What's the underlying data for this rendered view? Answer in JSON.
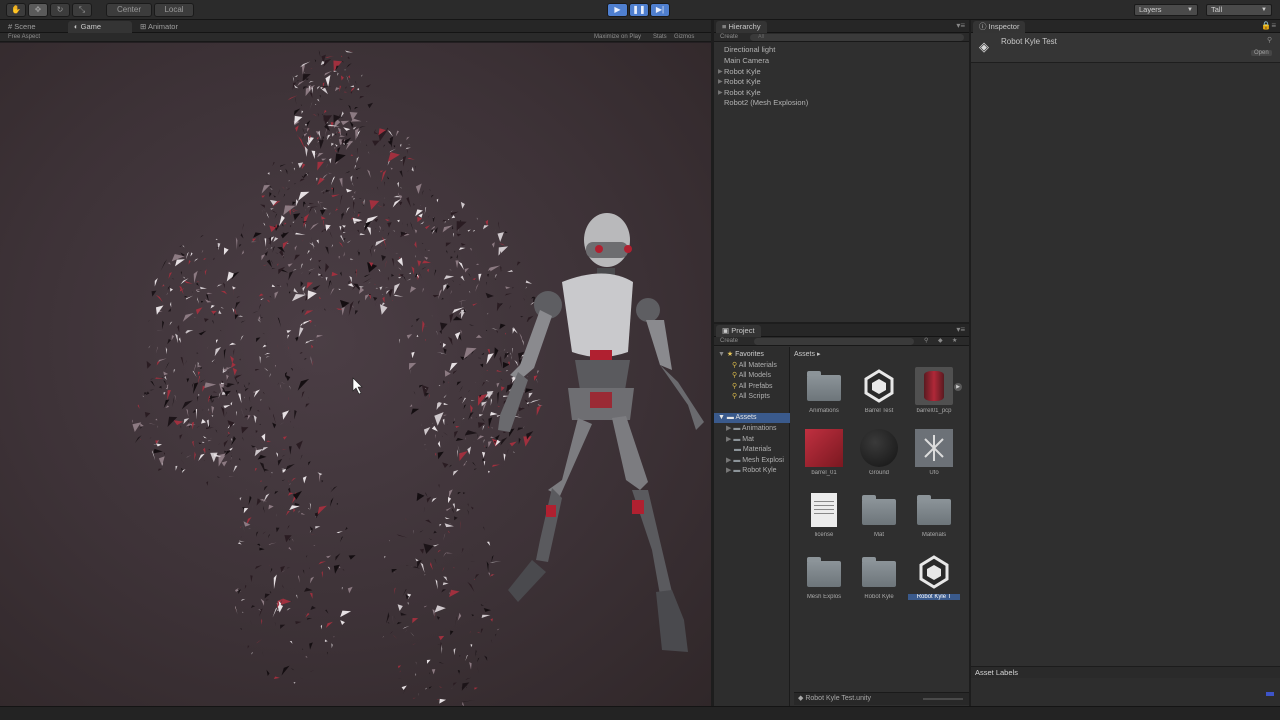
{
  "toolbar": {
    "pivot_label": "Center",
    "space_label": "Local",
    "layers_label": "Layers",
    "layout_label": "Tall"
  },
  "game_view": {
    "tabs": [
      "Scene",
      "Game",
      "Animator"
    ],
    "aspect_label": "Free Aspect",
    "maximize_label": "Maximize on Play",
    "stats_label": "Stats",
    "gizmos_label": "Gizmos"
  },
  "hierarchy": {
    "title": "Hierarchy",
    "create_label": "Create",
    "search_placeholder": "All",
    "items": [
      "Directional light",
      "Main Camera",
      "Robot Kyle",
      "Robot Kyle",
      "Robot Kyle",
      "Robot2 (Mesh Explosion)"
    ]
  },
  "project": {
    "title": "Project",
    "create_label": "Create",
    "favorites_label": "Favorites",
    "favorites": [
      "All Materials",
      "All Models",
      "All Prefabs",
      "All Scripts"
    ],
    "assets_label": "Assets",
    "asset_folders": [
      "Animations",
      "Mat",
      "Materials",
      "Mesh Explosi",
      "Robot Kyle"
    ],
    "breadcrumb": "Assets",
    "grid": [
      {
        "label": "Animations",
        "kind": "folder"
      },
      {
        "label": "Barrel Test",
        "kind": "unity"
      },
      {
        "label": "barrel01_pcp",
        "kind": "barrel"
      },
      {
        "label": "barrel_01",
        "kind": "material-red"
      },
      {
        "label": "Ground",
        "kind": "sphere"
      },
      {
        "label": "Ufo",
        "kind": "prefab"
      },
      {
        "label": "license",
        "kind": "doc"
      },
      {
        "label": "Mat",
        "kind": "folder"
      },
      {
        "label": "Materials",
        "kind": "folder"
      },
      {
        "label": "Mesh Explos",
        "kind": "folder"
      },
      {
        "label": "Robot Kyle",
        "kind": "folder"
      },
      {
        "label": "Robot Kyle T",
        "kind": "unity"
      }
    ],
    "footer_file": "Robot Kyle Test.unity"
  },
  "inspector": {
    "title": "Inspector",
    "object_name": "Robot Kyle Test",
    "open_label": "Open",
    "asset_labels": "Asset Labels"
  },
  "colors": {
    "accent": "#4f7fcf",
    "panel": "#2f2f2f",
    "viewport": "#3d3237",
    "robot_red": "#b02030"
  }
}
